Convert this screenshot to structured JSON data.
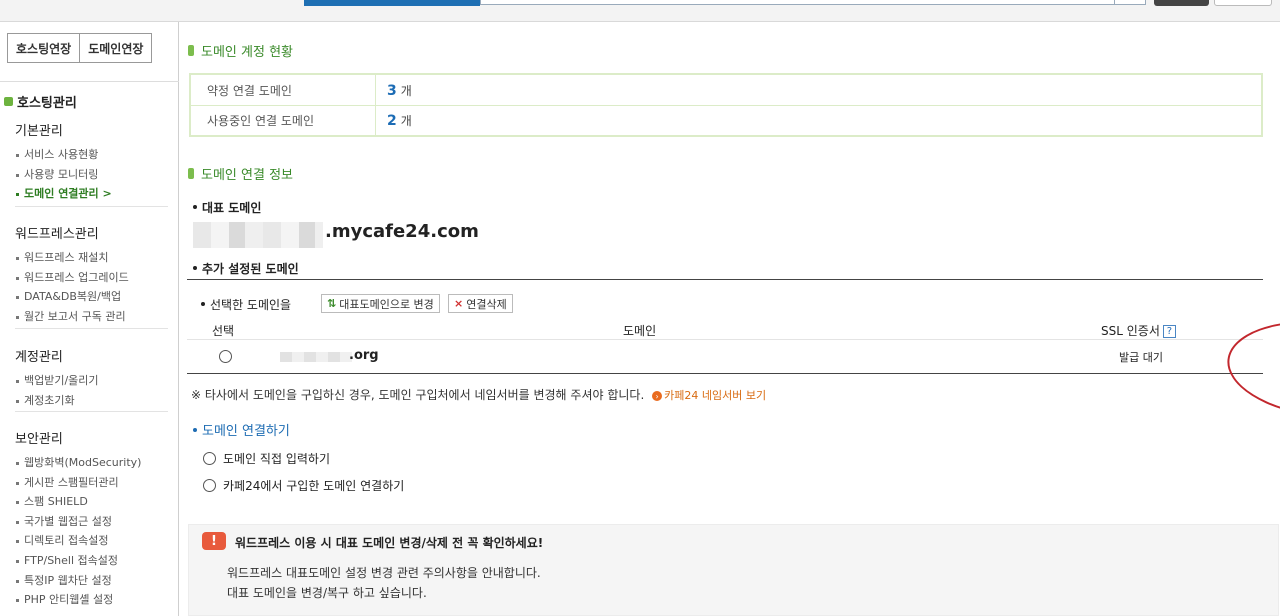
{
  "sidebar": {
    "ext_buttons": [
      "호스팅연장",
      "도메인연장"
    ],
    "section_title": "호스팅관리",
    "groups": [
      {
        "title": "기본관리",
        "items": [
          "서비스 사용현황",
          "사용량 모니터링",
          "도메인 연결관리 >"
        ],
        "active_index": 2
      },
      {
        "title": "워드프레스관리",
        "items": [
          "워드프레스 재설치",
          "워드프레스 업그레이드",
          "DATA&DB복원/백업",
          "월간 보고서 구독 관리"
        ]
      },
      {
        "title": "계정관리",
        "items": [
          "백업받기/올리기",
          "계정초기화"
        ]
      },
      {
        "title": "보안관리",
        "items": [
          "웹방화벽(ModSecurity)",
          "게시판 스팸필터관리",
          "스팸 SHIELD",
          "국가별 웹접근 설정",
          "디렉토리 접속설정",
          "FTP/Shell 접속설정",
          "특정IP 웹차단 설정",
          "PHP 안티웹셸 설정"
        ]
      }
    ]
  },
  "status": {
    "title": "도메인 계정 현황",
    "rows": [
      {
        "label": "약정 연결 도메인",
        "count": "3",
        "unit": "개"
      },
      {
        "label": "사용중인 연결 도메인",
        "count": "2",
        "unit": "개"
      }
    ]
  },
  "info": {
    "title": "도메인 연결 정보",
    "main_domain_label": "대표 도메인",
    "main_domain_suffix": ".mycafe24.com",
    "added_label": "추가 설정된 도메인",
    "action_label": "선택한 도메인을",
    "btn_make_main": "대표도메인으로 변경",
    "btn_delete": "연결삭제",
    "col_select": "선택",
    "col_domain": "도메인",
    "col_ssl": "SSL 인증서",
    "rows": [
      {
        "domain_suffix": ".org",
        "ssl": "발급 대기"
      }
    ],
    "notice": "※ 타사에서 도메인을 구입하신 경우, 도메인 구입처에서 네임서버를 변경해 주셔야 합니다.",
    "notice_link": "카페24 네임서버 보기"
  },
  "connect": {
    "title": "도메인 연결하기",
    "options": [
      "도메인 직접 입력하기",
      "카페24에서 구입한 도메인 연결하기"
    ]
  },
  "warning": {
    "badge": "!",
    "title": "워드프레스 이용 시 대표 도메인 변경/삭제 전 꼭 확인하세요!",
    "lines": [
      "워드프레스 대표도메인 설정 변경 관련 주의사항을 안내합니다.",
      "대표 도메인을 변경/복구 하고 싶습니다."
    ]
  },
  "colors": {
    "accent_green": "#3a8a2a",
    "accent_blue": "#1e6cb3",
    "annotation_red": "#c2272d"
  }
}
